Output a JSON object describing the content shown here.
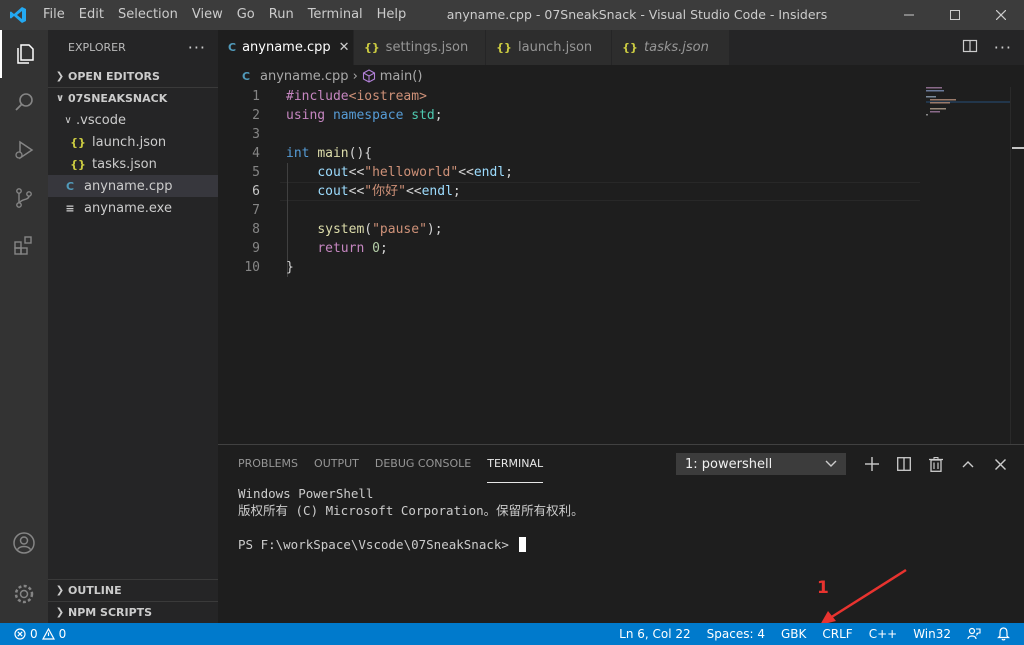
{
  "window": {
    "title": "anyname.cpp - 07SneakSnack - Visual Studio Code - Insiders",
    "menu": [
      "File",
      "Edit",
      "Selection",
      "View",
      "Go",
      "Run",
      "Terminal",
      "Help"
    ]
  },
  "activity_bar": {
    "items": [
      "explorer-icon",
      "search-icon",
      "run-debug-icon",
      "source-control-icon",
      "extensions-icon"
    ],
    "bottom": [
      "account-icon",
      "settings-gear-icon"
    ]
  },
  "sidebar": {
    "title": "EXPLORER",
    "more": "···",
    "open_editors": "OPEN EDITORS",
    "folder": "07SNEAKSNACK",
    "tree": {
      "vscode_folder": ".vscode",
      "launch": "launch.json",
      "tasks": "tasks.json",
      "cpp": "anyname.cpp",
      "exe": "anyname.exe"
    },
    "outline": "OUTLINE",
    "npm_scripts": "NPM SCRIPTS"
  },
  "tabs": [
    {
      "label": "anyname.cpp",
      "icon": "C",
      "active": true
    },
    {
      "label": "settings.json",
      "icon": "{}"
    },
    {
      "label": "launch.json",
      "icon": "{}"
    },
    {
      "label": "tasks.json",
      "icon": "{}",
      "italic": true
    }
  ],
  "breadcrumb": {
    "file": "anyname.cpp",
    "symbol": "main()"
  },
  "editor": {
    "line_numbers": [
      "1",
      "2",
      "3",
      "4",
      "5",
      "6",
      "7",
      "8",
      "9",
      "10"
    ],
    "code": {
      "l1_pre": "#include",
      "l1_inc": "<iostream>",
      "l2_using": "using",
      "l2_namespace": "namespace",
      "l2_std": "std",
      "l2_semi": ";",
      "l4_int": "int",
      "l4_main": "main",
      "l4_rest": "(){",
      "l5_cout": "cout",
      "l5_op1": "<<",
      "l5_str": "\"helloworld\"",
      "l5_op2": "<<",
      "l5_endl": "endl",
      "l5_semi": ";",
      "l6_cout": "cout",
      "l6_op1": "<<",
      "l6_str": "\"你好\"",
      "l6_op2": "<<",
      "l6_endl": "endl",
      "l6_semi": ";",
      "l8_system": "system",
      "l8_open": "(",
      "l8_str": "\"pause\"",
      "l8_close": ");",
      "l9_return": "return",
      "l9_zero": "0",
      "l9_semi": ";",
      "l10": "}"
    }
  },
  "panel": {
    "tabs": [
      "PROBLEMS",
      "OUTPUT",
      "DEBUG CONSOLE",
      "TERMINAL"
    ],
    "active_tab": "TERMINAL",
    "terminal_select": "1: powershell",
    "terminal_lines": [
      "Windows PowerShell",
      "版权所有 (C) Microsoft Corporation。保留所有权利。",
      "",
      "PS F:\\workSpace\\Vscode\\07SneakSnack> "
    ]
  },
  "annotation": {
    "number": "1",
    "color": "#e8332f"
  },
  "statusbar": {
    "errors": "0",
    "warnings": "0",
    "position": "Ln 6, Col 22",
    "spaces": "Spaces: 4",
    "encoding": "GBK",
    "eol": "CRLF",
    "language": "C++",
    "platform": "Win32"
  },
  "colors": {
    "statusbar": "#007acc",
    "titlebar": "#3c3c3c",
    "activitybar": "#333333",
    "sidebar": "#252526",
    "editor": "#1e1e1e"
  }
}
